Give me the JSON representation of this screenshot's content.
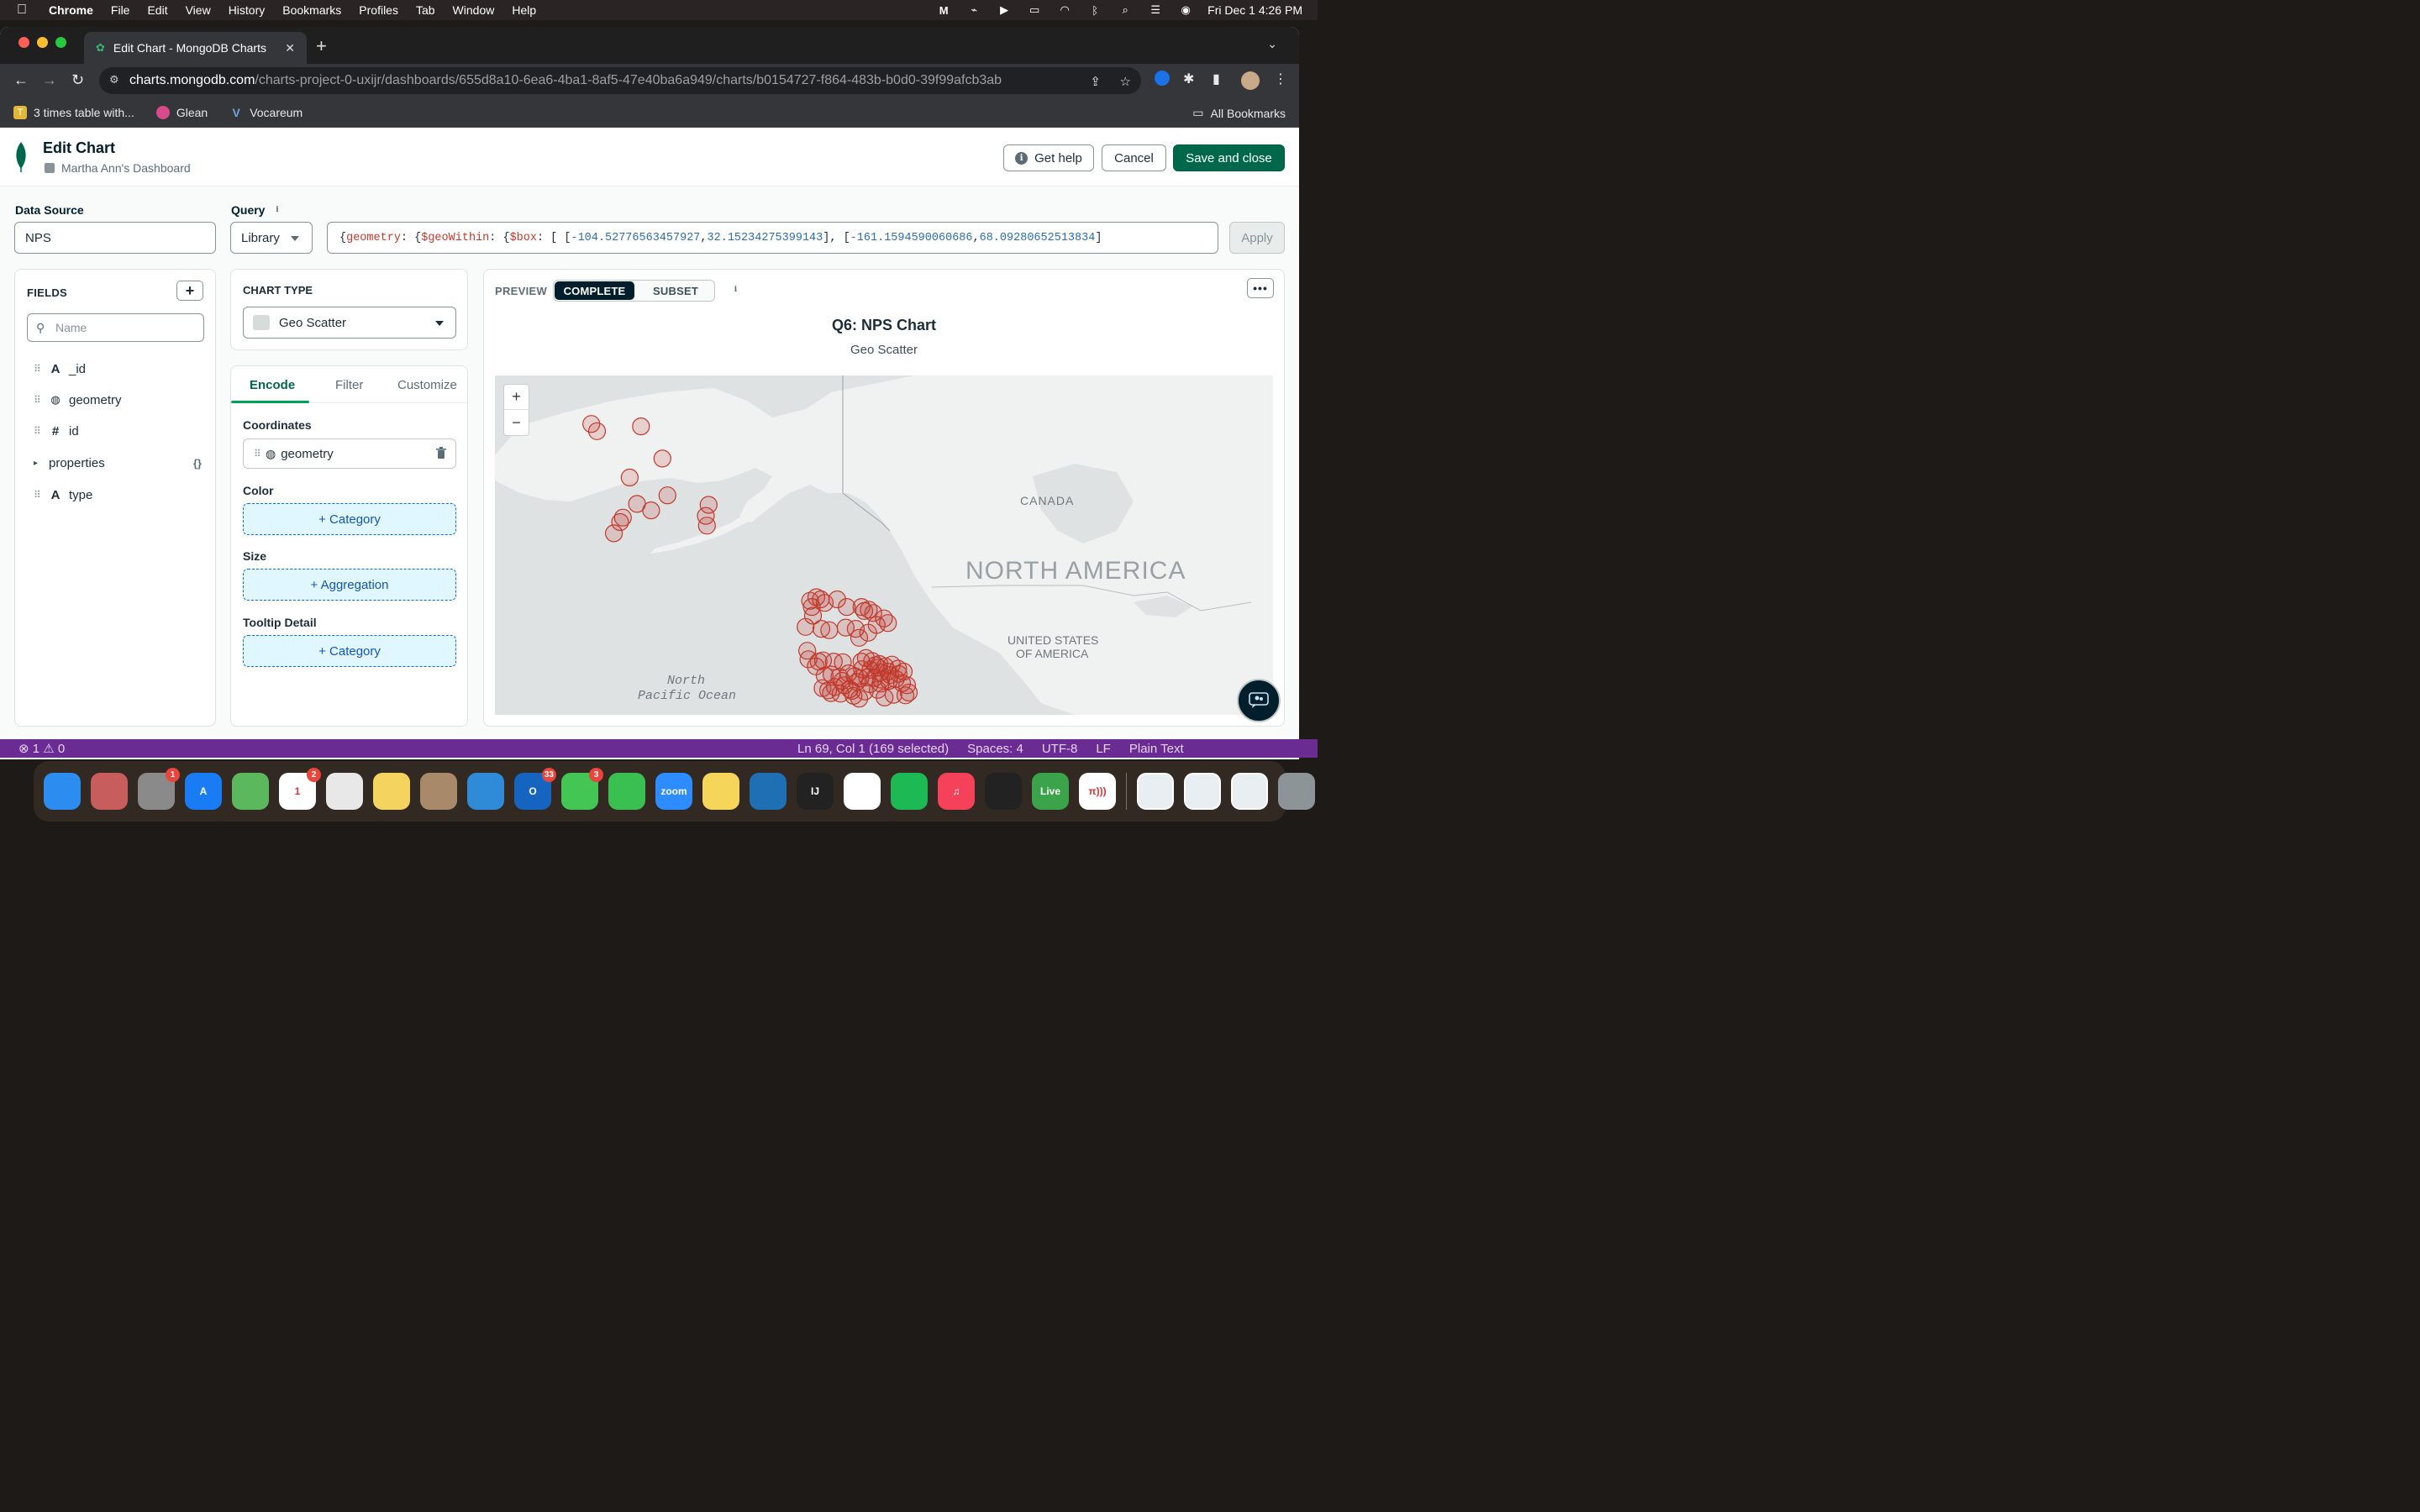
{
  "menubar": {
    "app": "Chrome",
    "items": [
      "File",
      "Edit",
      "View",
      "History",
      "Bookmarks",
      "Profiles",
      "Tab",
      "Window",
      "Help"
    ],
    "clock": "Fri Dec 1  4:26 PM"
  },
  "browser": {
    "tab_title": "Edit Chart - MongoDB Charts",
    "url_host": "charts.mongodb.com",
    "url_path": "/charts-project-0-uxijr/dashboards/655d8a10-6ea6-4ba1-8af5-47e40ba6a949/charts/b0154727-f864-483b-b0d0-39f99afcb3ab",
    "bookmarks": [
      {
        "label": "3 times table with...",
        "color": "#e0b73a",
        "glyph": "T"
      },
      {
        "label": "Glean",
        "color": "#d64b8c",
        "glyph": ""
      },
      {
        "label": "Vocareum",
        "color": "#3c78c8",
        "glyph": "V"
      }
    ],
    "all_bookmarks": "All Bookmarks"
  },
  "header": {
    "title": "Edit Chart",
    "dashboard": "Martha Ann's Dashboard",
    "help_label": "Get help",
    "cancel_label": "Cancel",
    "save_label": "Save and close"
  },
  "data_source": {
    "label": "Data Source",
    "value": "NPS"
  },
  "query": {
    "label": "Query",
    "mode": "Library",
    "parts": [
      {
        "t": "p",
        "v": "{ "
      },
      {
        "t": "k",
        "v": "geometry"
      },
      {
        "t": "p",
        "v": ": { "
      },
      {
        "t": "k",
        "v": "$geoWithin"
      },
      {
        "t": "p",
        "v": ": { "
      },
      {
        "t": "k",
        "v": "$box"
      },
      {
        "t": "p",
        "v": ": [ [ "
      },
      {
        "t": "n",
        "v": "-104.52776563457927"
      },
      {
        "t": "p",
        "v": ", "
      },
      {
        "t": "n",
        "v": "32.15234275399143"
      },
      {
        "t": "p",
        "v": " ], [ "
      },
      {
        "t": "n",
        "v": "-161.1594590060686"
      },
      {
        "t": "p",
        "v": ", "
      },
      {
        "t": "n",
        "v": "68.09280652513834"
      },
      {
        "t": "p",
        "v": " ]"
      }
    ],
    "apply_label": "Apply"
  },
  "fields": {
    "title": "FIELDS",
    "search_placeholder": "Name",
    "items": [
      {
        "name": "_id",
        "type_glyph": "A",
        "kind": "string"
      },
      {
        "name": "geometry",
        "type_glyph": "◍",
        "kind": "geo"
      },
      {
        "name": "id",
        "type_glyph": "#",
        "kind": "number"
      },
      {
        "name": "properties",
        "type_glyph": "▸",
        "kind": "object",
        "suffix": "{}"
      },
      {
        "name": "type",
        "type_glyph": "A",
        "kind": "string"
      }
    ]
  },
  "chart_type": {
    "label": "CHART TYPE",
    "value": "Geo Scatter"
  },
  "encode": {
    "tabs": [
      "Encode",
      "Filter",
      "Customize"
    ],
    "active_tab": "Encode",
    "coordinates_label": "Coordinates",
    "coordinates_field": "geometry",
    "color_label": "Color",
    "color_drop": "+ Category",
    "size_label": "Size",
    "size_drop": "+ Aggregation",
    "tooltip_label": "Tooltip Detail",
    "tooltip_drop": "+ Category"
  },
  "preview": {
    "label": "PREVIEW",
    "modes": [
      "COMPLETE",
      "SUBSET"
    ],
    "active_mode": "COMPLETE",
    "chart_title": "Q6: NPS Chart",
    "chart_subtitle": "Geo Scatter",
    "map_labels": {
      "country": "CANADA",
      "continent": "NORTH AMERICA",
      "us_line1": "UNITED STATES",
      "us_line2": "OF AMERICA",
      "ocean_line1": "North",
      "ocean_line2": "Pacific Ocean"
    },
    "zoom_in": "+",
    "zoom_out": "−",
    "marker_color": "#c0392b"
  },
  "chart_data": {
    "type": "scatter",
    "title": "Q6: NPS Chart",
    "subtitle": "Geo Scatter",
    "xlabel": "",
    "ylabel": "",
    "x": [
      -160.9,
      -159.9,
      -152.1,
      -148.3,
      -154.1,
      -147.4,
      -152.8,
      -150.3,
      -155.3,
      -155.8,
      -156.9,
      -140.1,
      -140.6,
      -140.4,
      -122.1,
      -121.0,
      -120.2,
      -119.5,
      -121.8,
      -117.3,
      -115.6,
      -113.0,
      -112.5,
      -111.7,
      -110.9,
      -109.0,
      -108.3,
      -110.3,
      -121.6,
      -122.9,
      -120.1,
      -118.7,
      -115.8,
      -114.0,
      -111.8,
      -113.4,
      -122.6,
      -122.4,
      -120.6,
      -121.1,
      -119.8,
      -117.9,
      -116.3,
      -113.0,
      -112.2,
      -111.1,
      -110.5,
      -109.8,
      -108.8,
      -107.6,
      -106.5,
      -105.5,
      -112.9,
      -111.4,
      -109.7,
      -108.3,
      -107.9,
      -106.4,
      -119.5,
      -118.3,
      -116.9,
      -115.3,
      -114.2,
      -113.2,
      -112.0,
      -110.7,
      -109.5,
      -108.1,
      -106.9,
      -105.8,
      -104.9,
      -111.5,
      -113.8,
      -116.0,
      -117.7,
      -115.1,
      -118.4,
      -112.4,
      -110.1,
      -114.7,
      -116.7,
      -118.9,
      -119.9,
      -114.4,
      -108.9,
      -107.3,
      -113.4,
      -105.2,
      -104.6,
      -109.6,
      -110.0,
      -116.4
    ],
    "y": [
      67.8,
      67.2,
      67.6,
      64.8,
      63.0,
      61.2,
      60.3,
      59.6,
      58.8,
      58.3,
      57.0,
      60.2,
      59.0,
      57.9,
      48.2,
      48.7,
      48.4,
      47.9,
      47.3,
      48.4,
      47.3,
      47.3,
      46.7,
      46.9,
      46.4,
      45.6,
      44.9,
      44.6,
      46.0,
      44.3,
      44.0,
      43.8,
      44.2,
      44.0,
      43.4,
      42.6,
      40.5,
      39.1,
      38.7,
      37.9,
      38.9,
      38.7,
      38.6,
      38.7,
      39.3,
      38.8,
      38.1,
      38.3,
      37.9,
      38.2,
      37.5,
      37.0,
      37.4,
      37.3,
      36.9,
      37.0,
      36.4,
      36.6,
      36.3,
      36.5,
      36.1,
      36.7,
      36.2,
      35.8,
      36.0,
      35.9,
      35.6,
      35.4,
      35.7,
      35.0,
      34.6,
      34.8,
      35.2,
      34.6,
      34.3,
      33.9,
      33.2,
      33.5,
      33.8,
      33.6,
      33.1,
      33.7,
      34.1,
      32.7,
      32.4,
      32.9,
      32.2,
      32.8,
      33.3,
      34.9,
      37.7,
      35.4
    ],
    "xlim": [
      -178,
      -40
    ],
    "ylim": [
      25,
      72
    ],
    "grid": false,
    "legend": "none",
    "marker": "circle"
  },
  "statusbar": {
    "problems": "⊗ 1 ⚠ 0",
    "cursor": "Ln 69, Col 1 (169 selected)",
    "spaces": "Spaces: 4",
    "encoding": "UTF-8",
    "eol": "LF",
    "language": "Plain Text"
  },
  "dock": {
    "apps": [
      {
        "name": "finder",
        "color": "#2d8cf0",
        "glyph": ""
      },
      {
        "name": "launchpad",
        "color": "#c75d5d",
        "glyph": ""
      },
      {
        "name": "system-settings",
        "color": "#8a8a8a",
        "glyph": "",
        "badge": "1"
      },
      {
        "name": "app-store",
        "color": "#1a7cf5",
        "glyph": "A"
      },
      {
        "name": "maps",
        "color": "#5cb85c",
        "glyph": ""
      },
      {
        "name": "calendar",
        "color": "#ffffff",
        "glyph": "1",
        "badge": "2"
      },
      {
        "name": "chrome",
        "color": "#e8e8e8",
        "glyph": ""
      },
      {
        "name": "photos",
        "color": "#f4d35e",
        "glyph": ""
      },
      {
        "name": "contacts",
        "color": "#a88a6a",
        "glyph": ""
      },
      {
        "name": "safari",
        "color": "#2f8bd8",
        "glyph": ""
      },
      {
        "name": "outlook",
        "color": "#1565c0",
        "glyph": "O",
        "badge": "33"
      },
      {
        "name": "messages",
        "color": "#43c653",
        "glyph": "",
        "badge": "3"
      },
      {
        "name": "facetime",
        "color": "#3ac051",
        "glyph": ""
      },
      {
        "name": "zoom",
        "color": "#2d8cff",
        "glyph": "zoom"
      },
      {
        "name": "notes",
        "color": "#f6d65a",
        "glyph": ""
      },
      {
        "name": "vscode",
        "color": "#1f6fb5",
        "glyph": ""
      },
      {
        "name": "intellij",
        "color": "#222",
        "glyph": "IJ"
      },
      {
        "name": "slack",
        "color": "#fff",
        "glyph": ""
      },
      {
        "name": "spotify",
        "color": "#1db954",
        "glyph": ""
      },
      {
        "name": "music",
        "color": "#f5425a",
        "glyph": "♫"
      },
      {
        "name": "cinema",
        "color": "#222",
        "glyph": ""
      },
      {
        "name": "live",
        "color": "#3ba34a",
        "glyph": "Live"
      },
      {
        "name": "pi",
        "color": "#fff",
        "glyph": "π)))"
      }
    ],
    "recents_label": ""
  }
}
